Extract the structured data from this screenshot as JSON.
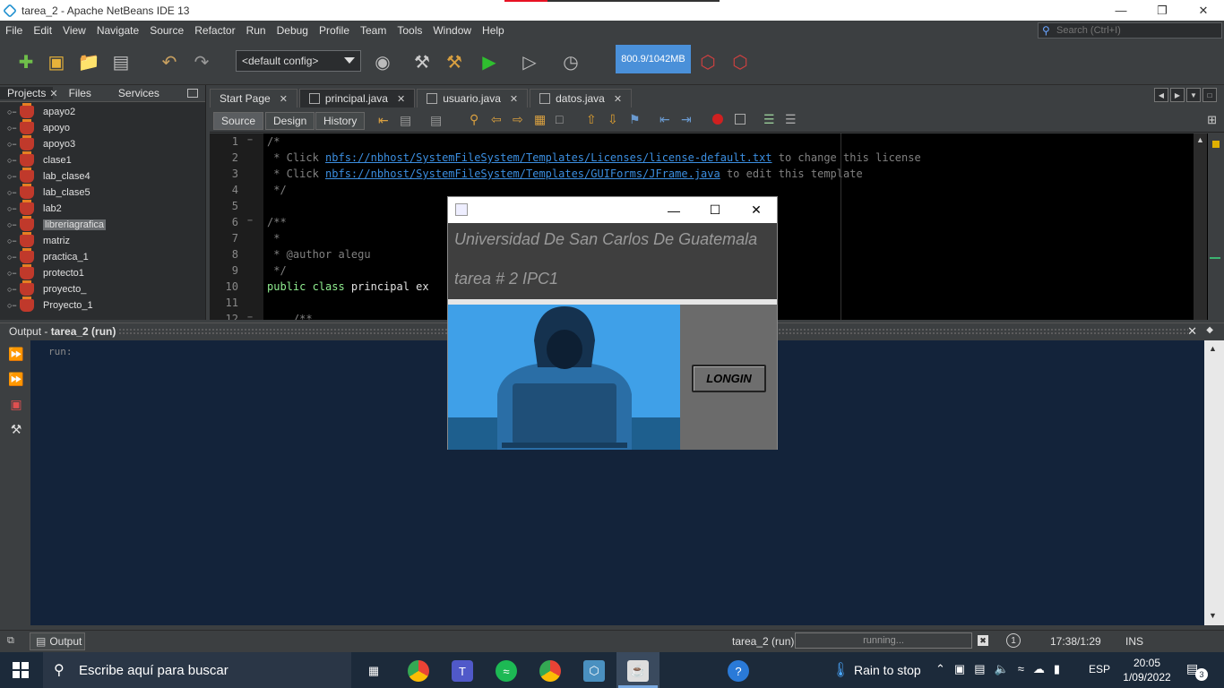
{
  "window": {
    "title": "tarea_2 - Apache NetBeans IDE 13",
    "minimize": "—",
    "restore": "❐",
    "close": "✕"
  },
  "menu": [
    "File",
    "Edit",
    "View",
    "Navigate",
    "Source",
    "Refactor",
    "Run",
    "Debug",
    "Profile",
    "Team",
    "Tools",
    "Window",
    "Help"
  ],
  "search": {
    "placeholder": "Search (Ctrl+I)"
  },
  "toolbar": {
    "config": "<default config>",
    "memory": "800.9/1042MB"
  },
  "projects_panel": {
    "tabs": [
      "Projects",
      "Files",
      "Services"
    ],
    "close": "✕",
    "items": [
      {
        "label": "apayo2"
      },
      {
        "label": "apoyo"
      },
      {
        "label": "apoyo3"
      },
      {
        "label": "clase1"
      },
      {
        "label": "lab_clase4"
      },
      {
        "label": "lab_clase5"
      },
      {
        "label": "lab2"
      },
      {
        "label": "libreriagrafica"
      },
      {
        "label": "matriz"
      },
      {
        "label": "practica_1"
      },
      {
        "label": "protecto1"
      },
      {
        "label": "proyecto_"
      },
      {
        "label": "Proyecto_1"
      }
    ],
    "selected": "libreriagrafica"
  },
  "editor": {
    "tabs": [
      {
        "label": "Start Page",
        "close": "✕"
      },
      {
        "label": "principal.java",
        "close": "✕"
      },
      {
        "label": "usuario.java",
        "close": "✕"
      },
      {
        "label": "datos.java",
        "close": "✕"
      }
    ],
    "views": [
      "Source",
      "Design",
      "History"
    ],
    "lines": [
      {
        "n": "1",
        "fold": "−",
        "text": "/*"
      },
      {
        "n": "2",
        "fold": "",
        "pre": " * Click ",
        "link": "nbfs://nbhost/SystemFileSystem/Templates/Licenses/license-default.txt",
        "post": " to change this license"
      },
      {
        "n": "3",
        "fold": "",
        "pre": " * Click ",
        "link": "nbfs://nbhost/SystemFileSystem/Templates/GUIForms/JFrame.java",
        "post": " to edit this template"
      },
      {
        "n": "4",
        "fold": "",
        "text": " */"
      },
      {
        "n": "5",
        "fold": "",
        "text": ""
      },
      {
        "n": "6",
        "fold": "−",
        "text": "/**"
      },
      {
        "n": "7",
        "fold": "",
        "text": " *"
      },
      {
        "n": "8",
        "fold": "",
        "text": " * @author alegu"
      },
      {
        "n": "9",
        "fold": "",
        "text": " */"
      },
      {
        "n": "10",
        "fold": "",
        "kw": "public class ",
        "plain": "principal ex"
      },
      {
        "n": "11",
        "fold": "",
        "text": ""
      },
      {
        "n": "12",
        "fold": "−",
        "text": "    /**"
      }
    ]
  },
  "output": {
    "title_prefix": "Output - ",
    "title_bold": "tarea_2 (run)",
    "close": "✕",
    "text": "run:"
  },
  "statusbar": {
    "output_label": "Output",
    "task": "tarea_2 (run)",
    "progress": "running...",
    "position": "17:38/1:29",
    "mode": "INS",
    "notifications": "1"
  },
  "taskbar": {
    "search_text": "Escribe aquí para buscar",
    "weather": "Rain to stop",
    "language": "ESP",
    "time": "20:05",
    "date": "1/09/2022",
    "notif_count": "3"
  },
  "dialog": {
    "line1": "Universidad De San Carlos De Guatemala",
    "line2": "tarea # 2 IPC1",
    "button": "LONGIN",
    "minimize": "—",
    "maximize": "☐",
    "close": "✕"
  },
  "colors": {
    "ide_bg": "#3c3f41",
    "editor_bg": "#000000",
    "output_bg": "#13233a",
    "memory_bar": "#4a90d9",
    "dialog_bg": "#6b6b6b",
    "image_bg": "#3fa0e8"
  }
}
